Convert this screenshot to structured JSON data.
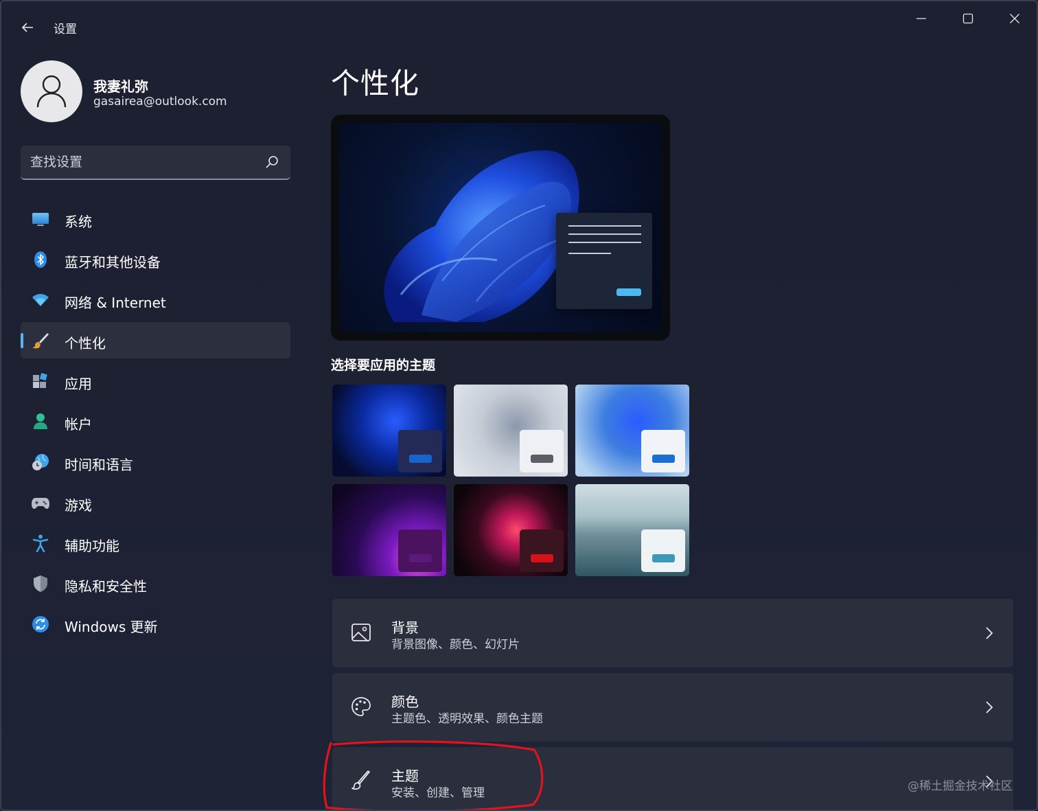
{
  "window": {
    "title": "设置"
  },
  "profile": {
    "name": "我妻礼弥",
    "email": "gasairea@outlook.com"
  },
  "search": {
    "placeholder": "查找设置"
  },
  "nav": {
    "items": [
      {
        "label": "系统",
        "icon": "monitor-icon"
      },
      {
        "label": "蓝牙和其他设备",
        "icon": "bluetooth-icon"
      },
      {
        "label": "网络 & Internet",
        "icon": "wifi-icon"
      },
      {
        "label": "个性化",
        "icon": "brush-icon",
        "active": true
      },
      {
        "label": "应用",
        "icon": "apps-icon"
      },
      {
        "label": "帐户",
        "icon": "person-icon"
      },
      {
        "label": "时间和语言",
        "icon": "globe-clock-icon"
      },
      {
        "label": "游戏",
        "icon": "gamepad-icon"
      },
      {
        "label": "辅助功能",
        "icon": "accessibility-icon"
      },
      {
        "label": "隐私和安全性",
        "icon": "shield-icon"
      },
      {
        "label": "Windows 更新",
        "icon": "update-icon"
      }
    ]
  },
  "main": {
    "title": "个性化",
    "theme_section_title": "选择要应用的主题",
    "themes": [
      {
        "name": "windows-dark",
        "bg": "#0a1a4a",
        "accent": "#1a63c9"
      },
      {
        "name": "glow",
        "bg": "#cdd3db",
        "accent": "#5b5e66"
      },
      {
        "name": "windows-light",
        "bg": "#9dc0e6",
        "accent": "#1c6fd1"
      },
      {
        "name": "captured-motion",
        "bg": "#1a0a33",
        "accent": "#5a1a7a"
      },
      {
        "name": "flow",
        "bg": "#120810",
        "accent": "#d6111b"
      },
      {
        "name": "sunrise",
        "bg": "#6f8f9a",
        "accent": "#3a9ab8"
      }
    ],
    "cards": [
      {
        "title": "背景",
        "subtitle": "背景图像、颜色、幻灯片",
        "icon": "image-icon"
      },
      {
        "title": "颜色",
        "subtitle": "主题色、透明效果、颜色主题",
        "icon": "palette-icon"
      },
      {
        "title": "主题",
        "subtitle": "安装、创建、管理",
        "icon": "brush-icon"
      }
    ]
  },
  "watermark": "@稀土掘金技术社区",
  "colors": {
    "accent": "#5fb2f2",
    "annotation": "#e0141e"
  }
}
